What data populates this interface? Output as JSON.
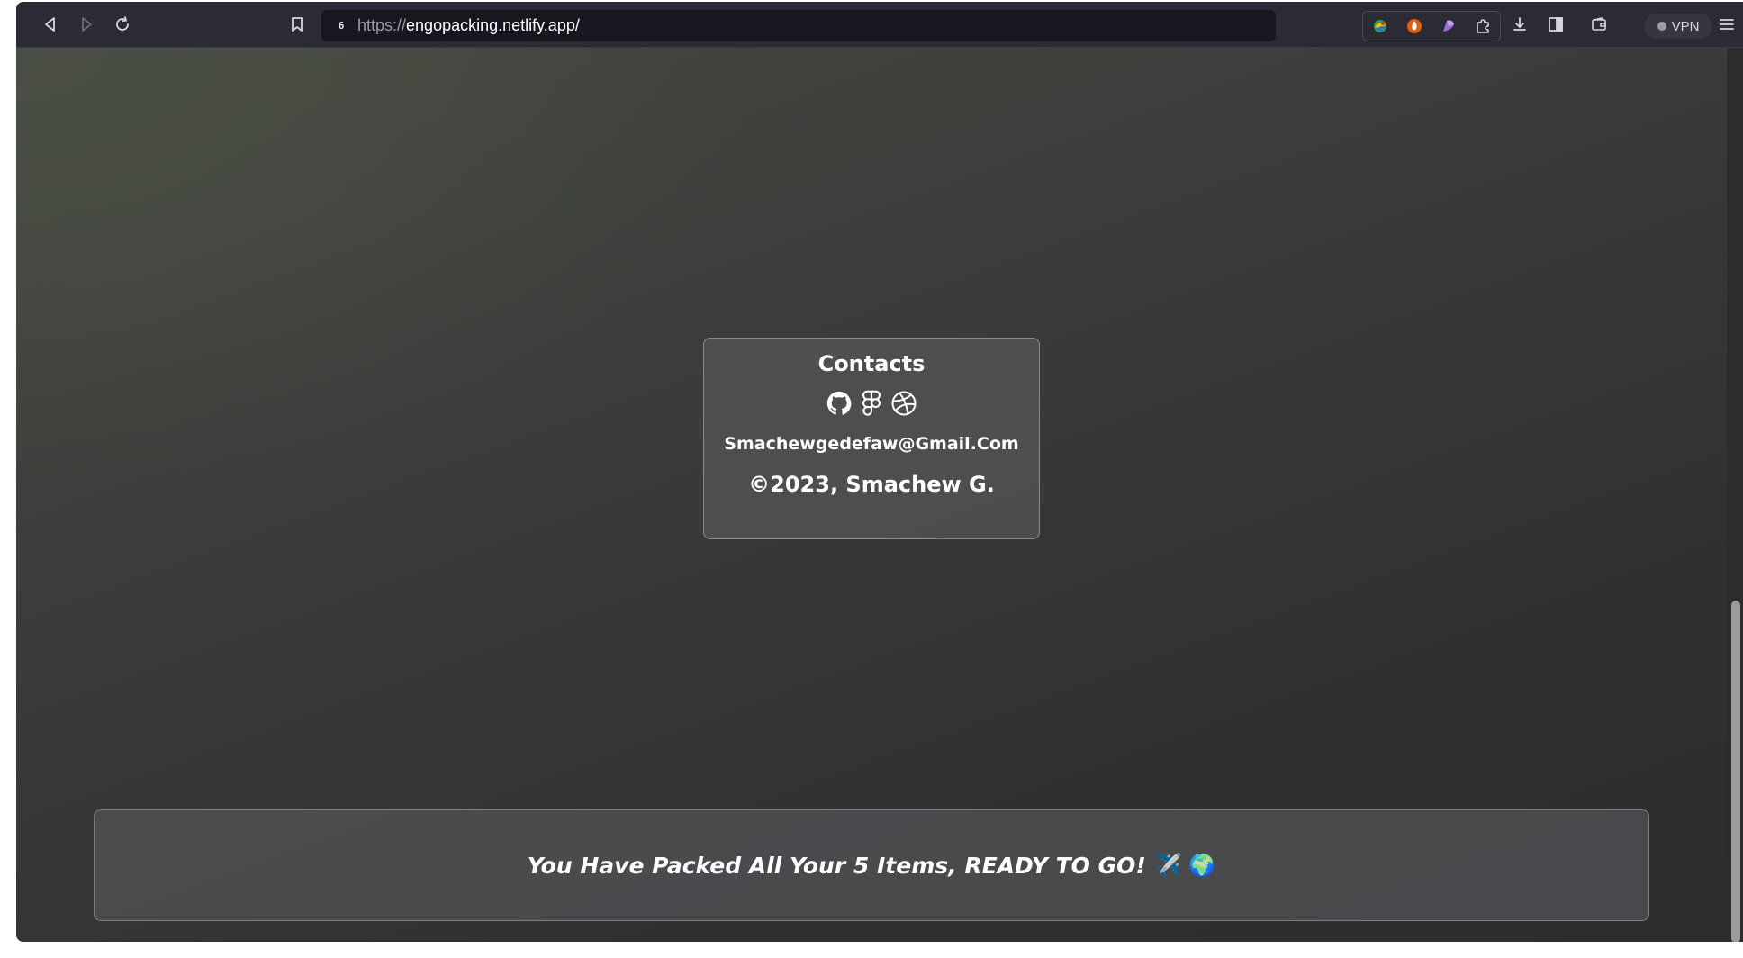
{
  "browser": {
    "url_scheme": "https://",
    "url_host": "engopacking.netlify.app/",
    "site_icon_text": "6",
    "vpn_label": "VPN"
  },
  "icons": {
    "back": "back-arrow-icon",
    "forward": "forward-arrow-icon",
    "reload": "reload-icon",
    "bookmark": "bookmark-icon",
    "extensions": [
      "browser-ext-icon",
      "flame-ext-icon",
      "purple-ext-icon",
      "puzzle-ext-icon"
    ],
    "download": "download-icon",
    "sidebar": "sidebar-icon",
    "wallet": "wallet-icon",
    "menu": "hamburger-menu-icon",
    "social": [
      "github-icon",
      "figma-icon",
      "dribbble-icon"
    ]
  },
  "contacts": {
    "title": "Contacts",
    "email": "Smachewgedefaw@Gmail.Com",
    "copyright": "©2023, Smachew G."
  },
  "stats": {
    "message": "You Have Packed All Your 5 Items, READY TO GO!",
    "emoji": "✈️ 🌍"
  },
  "colors": {
    "toolbar_bg": "#2a2b35",
    "page_bg": "#2f3031",
    "card_bg": "#555658",
    "text": "#ffffff"
  }
}
